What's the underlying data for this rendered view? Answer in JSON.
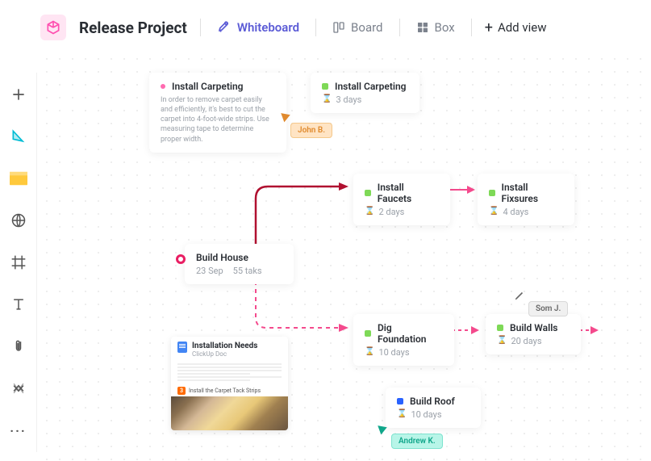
{
  "header": {
    "title": "Release Project",
    "tabs": {
      "whiteboard": "Whiteboard",
      "board": "Board",
      "box": "Box"
    },
    "add_view": "Add view"
  },
  "cards": {
    "carpeting_detail": {
      "title": "Install Carpeting",
      "desc": "In order to remove carpet easily and efficiently, it's best to cut the carpet into 4-foot-wide strips. Use measuring tape to determine proper width."
    },
    "carpeting_dur": {
      "title": "Install Carpeting",
      "duration": "3 days",
      "color": "#7ed957"
    },
    "faucets": {
      "title": "Install Faucets",
      "duration": "2 days",
      "color": "#7ed957"
    },
    "fixtures": {
      "title": "Install Fixsures",
      "duration": "4 days",
      "color": "#7ed957"
    },
    "build_house": {
      "title": "Build House",
      "date": "23 Sep",
      "tasks": "55 taks"
    },
    "dig": {
      "title": "Dig Foundation",
      "duration": "10 days",
      "color": "#7ed957"
    },
    "walls": {
      "title": "Build Walls",
      "duration": "20 days",
      "color": "#7ed957"
    },
    "roof": {
      "title": "Build Roof",
      "duration": "10 days",
      "color": "#2962ff"
    }
  },
  "cursors": {
    "john": "John B.",
    "som": "Som J.",
    "andrew": "Andrew K."
  },
  "doc": {
    "title": "Installation Needs",
    "subtitle": "ClickUp Doc",
    "section_num": "3",
    "section": "Install the Carpet Tack Strips"
  },
  "hourglass": "⌛"
}
